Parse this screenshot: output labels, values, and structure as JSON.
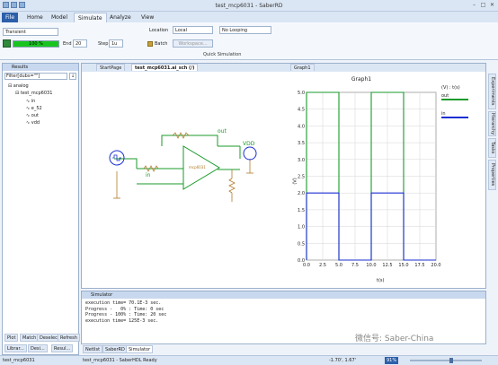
{
  "window": {
    "title": "test_mcp6031 - SaberRD"
  },
  "ribbon_tabs": [
    "File",
    "Home",
    "Model",
    "Simulate",
    "Analyze",
    "View"
  ],
  "ribbon": {
    "analysis_type": "Transient",
    "progress_label": "100 %",
    "progress_fraction": 1.0,
    "end_label": "End",
    "end_value": "20",
    "step_label": "Step",
    "step_value": "1u",
    "batch_label": "Batch",
    "location_label": "Location",
    "location_value": "Local",
    "workspace_label": "Workspace...",
    "looping_value": "No Looping",
    "group_label": "Quick Simulation"
  },
  "results_panel": {
    "title": "Results",
    "filter_value": "Filter[dubs=\"\"]",
    "tree": [
      "analog",
      "test_mcp6031",
      "in",
      "e_52",
      "out",
      "vdd"
    ],
    "buttons": [
      "Plot",
      "Match",
      "Deselect",
      "Refresh"
    ],
    "bottom_tabs": [
      "Librar...",
      "Desi...",
      "Resul..."
    ]
  },
  "doc_tabs": [
    "StartPage",
    "test_mcp6031.ai_sch (/)",
    "Graph1"
  ],
  "schematic": {
    "labels": {
      "out": "out",
      "vdd": "VDD",
      "in": "in",
      "opamp": "mcp6031"
    }
  },
  "graph": {
    "title": "Graph1",
    "legend_header": "(V) : t(s)",
    "ylabel": "(V)",
    "xlabel": "t(s)"
  },
  "chart_data": {
    "type": "line",
    "title": "Graph1",
    "xlabel": "t(s)",
    "ylabel": "(V)",
    "xlim": [
      0,
      20
    ],
    "ylim": [
      0,
      5
    ],
    "xticks": [
      "0.0",
      "2.5",
      "5.0",
      "7.5",
      "10.0",
      "12.5",
      "15.0",
      "17.5",
      "20.0"
    ],
    "yticks": [
      "0.0",
      "0.5",
      "1.0",
      "1.5",
      "2.0",
      "2.5",
      "3.0",
      "3.5",
      "4.0",
      "4.5",
      "5.0"
    ],
    "grid": true,
    "legend_position": "right",
    "series": [
      {
        "name": "out",
        "color": "#1a9b2a",
        "x": [
          0,
          0,
          5,
          5,
          10,
          10,
          15,
          15,
          20
        ],
        "y": [
          0,
          5,
          5,
          0,
          0,
          5,
          5,
          0,
          0
        ]
      },
      {
        "name": "in",
        "color": "#1a2fd1",
        "x": [
          0,
          0,
          5,
          5,
          10,
          10,
          15,
          15,
          20
        ],
        "y": [
          0,
          2,
          2,
          0,
          0,
          2,
          2,
          0,
          0
        ]
      }
    ]
  },
  "right_vtabs": [
    "Experiments",
    "Hierarchy",
    "Tasks",
    "Properties"
  ],
  "simulator": {
    "title": "Simulator",
    "lines": [
      "execution time= 70.1E-3 sec.",
      "Progress -   0% : Time: 0 sec",
      "Progress - 100% : Time: 20 sec",
      "execution time= 125E-3 sec."
    ]
  },
  "bottom_tabs": [
    "Netlist",
    "SaberRD",
    "Simulator"
  ],
  "status": {
    "left": "test_mcp6031",
    "message": "test_mcp6031 - SaberHDL Ready",
    "coords": "-1.70', 1.67'",
    "zoom": "91%"
  },
  "watermark": "微信号: Saber-China"
}
